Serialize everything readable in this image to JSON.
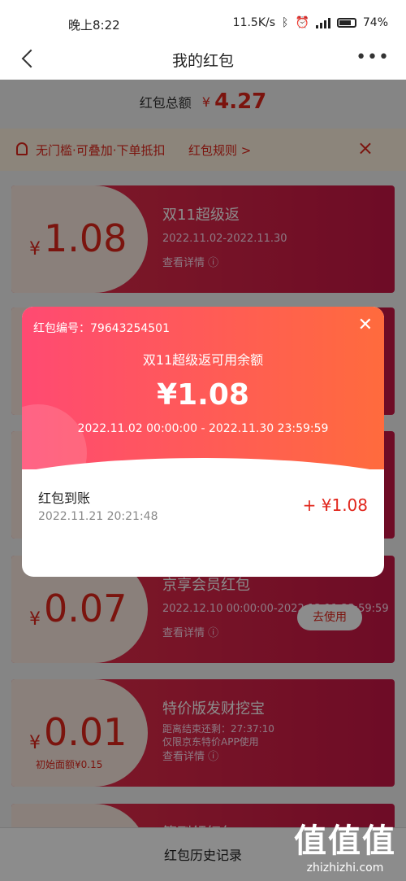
{
  "status": {
    "time": "晚上8:22",
    "net": "11.5K/s",
    "battery": "74%"
  },
  "nav": {
    "title": "我的红包"
  },
  "total": {
    "label": "红包总额",
    "currency": "¥",
    "amount": "4.27"
  },
  "tip": {
    "text": "无门槛·可叠加·下单抵扣",
    "rule": "红包规则 >"
  },
  "cards": [
    {
      "currency": "¥",
      "value": "1.08",
      "name": "双11超级返",
      "date": "2022.11.02-2022.11.30",
      "detail": "查看详情 ⓘ"
    },
    {
      "currency": "¥",
      "value": "0.07",
      "name": "京享会员红包",
      "date": "2022.12.10 00:00:00-2022.12.11 23:59:59",
      "detail": "查看详情 ⓘ",
      "use": "去使用"
    },
    {
      "currency": "¥",
      "value": "0.01",
      "sub": "初始面额¥0.15",
      "name": "特价版发财挖宝",
      "countdown": "距离结束还剩：27:37:10",
      "limit": "仅限京东特价APP使用",
      "detail": "查看详情 ⓘ"
    },
    {
      "name": "签到领红包"
    }
  ],
  "bottom": {
    "history": "红包历史记录"
  },
  "watermark": {
    "big": "值值值",
    "small": "zhizhizhi.com"
  },
  "modal": {
    "number": "红包编号：79643254501",
    "title": "双11超级返可用余额",
    "amount": "¥1.08",
    "period": "2022.11.02 00:00:00 - 2022.11.30 23:59:59",
    "record_label": "红包到账",
    "record_time": "2022.11.21 20:21:48",
    "record_amount": "+ ¥1.08"
  }
}
